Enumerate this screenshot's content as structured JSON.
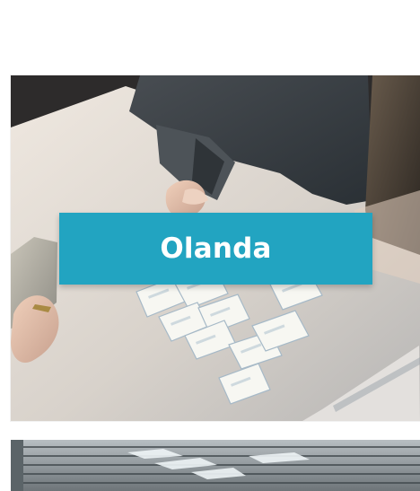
{
  "card": {
    "title": "Olanda",
    "banner_color": "#22a4c1"
  },
  "images": [
    {
      "name": "people-playing-card-game-photo"
    },
    {
      "name": "window-blinds-photo"
    }
  ]
}
